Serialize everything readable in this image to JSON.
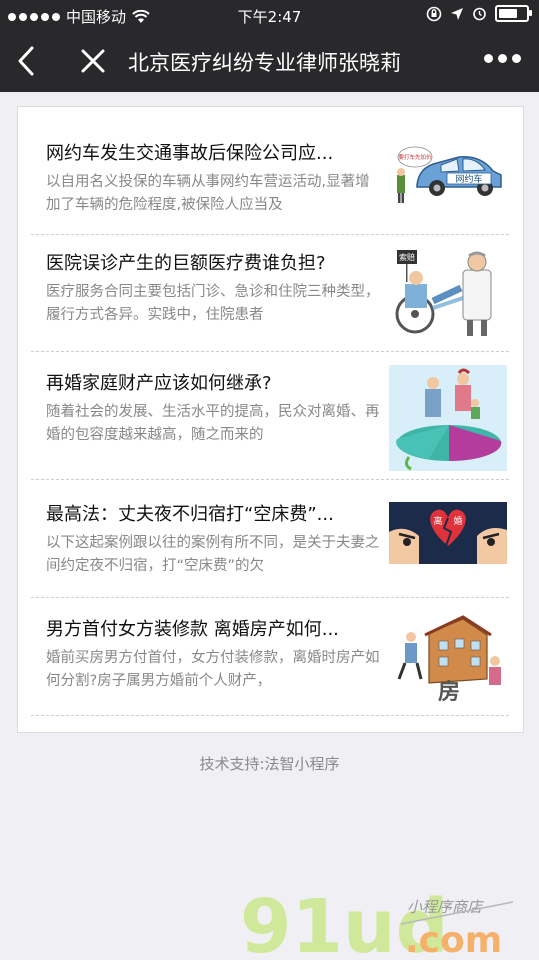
{
  "status": {
    "carrier": "中国移动",
    "time": "下午2:47"
  },
  "nav": {
    "title": "北京医疗纠纷专业律师张晓莉"
  },
  "articles": [
    {
      "title": "网约车发生交通事故后保险公司应...",
      "desc": "以自用名义投保的车辆从事网约车营运活动,显著增加了车辆的危险程度,被保险人应当及",
      "image": "car-cartoon",
      "image_texts": [
        "要打车先加价",
        "网约车"
      ]
    },
    {
      "title": "医院误诊产生的巨额医疗费谁负担?",
      "desc": "医疗服务合同主要包括门诊、急诊和住院三种类型，履行方式各异。实践中，住院患者",
      "image": "hospital-cartoon",
      "image_texts": [
        "索赔"
      ]
    },
    {
      "title": "再婚家庭财产应该如何继承?",
      "desc": "随着社会的发展、生活水平的提高，民众对离婚、再婚的包容度越来越高，随之而来的",
      "image": "family-pie-cartoon",
      "image_texts": []
    },
    {
      "title": "最高法：丈夫夜不归宿打“空床费”...",
      "desc": "以下这起案例跟以往的案例有所不同，是关于夫妻之间约定夜不归宿，打“空床费”的欠",
      "image": "divorce-cartoon",
      "image_texts": [
        "离",
        "婚"
      ]
    },
    {
      "title": "男方首付女方装修款  离婚房产如何...",
      "desc": "婚前买房男方付首付，女方付装修款，离婚时房产如何分割?房子属男方婚前个人财产，",
      "image": "house-cartoon",
      "image_texts": [
        "房"
      ]
    }
  ],
  "footer": {
    "text": "技术支持:法智小程序"
  },
  "watermark": {
    "logo": "91ud",
    "domain": ".com",
    "tagline": "小程序商店"
  }
}
